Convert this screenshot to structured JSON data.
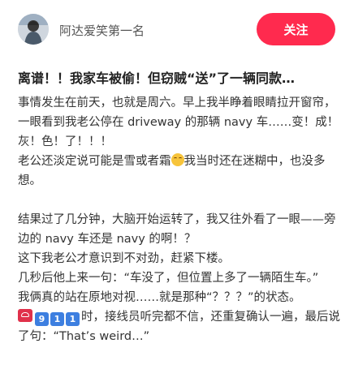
{
  "header": {
    "author_name": "阿达爱笑第一名",
    "follow_label": "关注"
  },
  "post": {
    "title": "离谱！！我家车被偷！但窃贼“送”了一辆同款…",
    "p1": "事情发生在前天，也就是周六。早上我半睁着眼睛拉开窗帘，一眼看到我老公停在 driveway 的那辆 navy 车……变！成！灰！色！了！！！",
    "p2_before": "老公还淡定说可能是雪或者霜",
    "p2_after": "我当时还在迷糊中，也没多想。",
    "p3": "结果过了几分钟，大脑开始运转了，我又往外看了一眼——旁边的 navy 车还是 navy 的啊！？",
    "p4": "这下我老公才意识到不对劲，赶紧下楼。",
    "p5": "几秒后他上来一句：“车没了，但位置上多了一辆陌生车。”",
    "p6": "我俩真的站在原地对视……就是那种“？？？”的状态。",
    "call_keys": [
      "9",
      "1",
      "1"
    ],
    "p7_after": "时，接线员听完都不信，还重复确认一遍，最后说了句：“That’s weird…”"
  },
  "icons": {
    "avatar": "user-avatar",
    "emoji": "grinning-sweat-emoji",
    "phone": "telephone-icon"
  },
  "colors": {
    "follow_button": "#ff2a4e",
    "keycap": "#3d7fe0"
  }
}
